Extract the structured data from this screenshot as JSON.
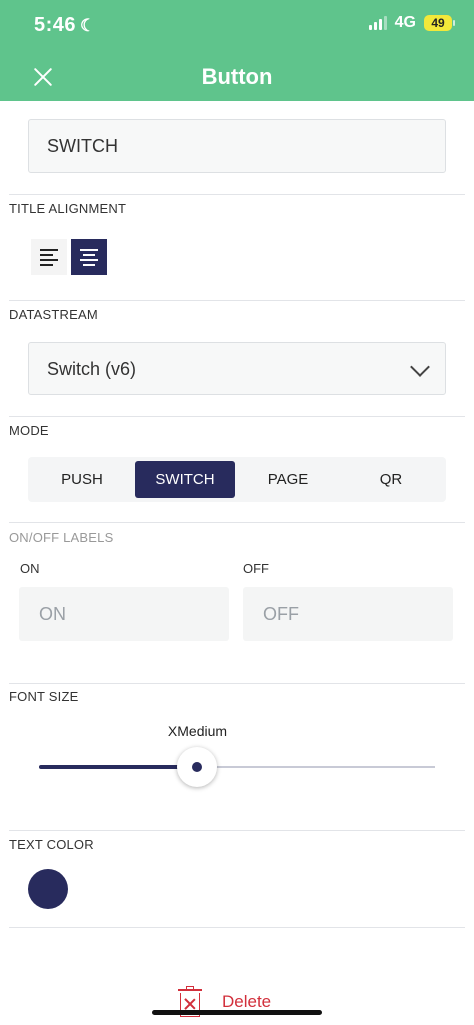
{
  "status_bar": {
    "time": "5:46",
    "network": "4G",
    "battery": "49"
  },
  "header": {
    "title": "Button"
  },
  "title_field": {
    "value": "SWITCH"
  },
  "title_alignment": {
    "label": "TITLE ALIGNMENT",
    "selected": "center"
  },
  "datastream": {
    "label": "DATASTREAM",
    "selected": "Switch (v6)"
  },
  "mode": {
    "label": "MODE",
    "options": [
      "PUSH",
      "SWITCH",
      "PAGE",
      "QR"
    ],
    "selected": "SWITCH"
  },
  "onoff_labels": {
    "label": "ON/OFF LABELS",
    "on_label": "ON",
    "on_placeholder": "ON",
    "off_label": "OFF",
    "off_placeholder": "OFF"
  },
  "font_size": {
    "label": "FONT SIZE",
    "value_label": "XMedium",
    "fraction": 0.4
  },
  "text_color": {
    "label": "TEXT COLOR",
    "color": "#282b5d"
  },
  "actions": {
    "delete_label": "Delete"
  },
  "colors": {
    "header_bg": "#5fc48c",
    "accent": "#282b5d",
    "danger": "#d22f3b"
  }
}
